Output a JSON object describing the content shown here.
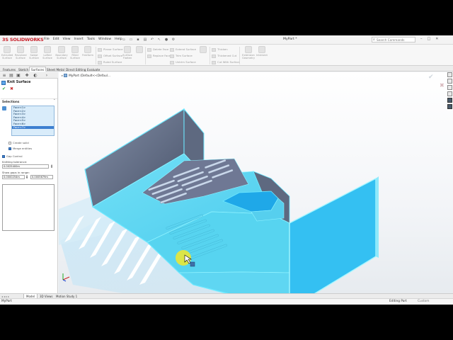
{
  "app": {
    "brand_mark": "3S",
    "brand_name": "SOLIDWORKS",
    "document_title": "MyPart *",
    "search_placeholder": "Search Commands"
  },
  "menu": [
    "File",
    "Edit",
    "View",
    "Insert",
    "Tools",
    "Window",
    "Help"
  ],
  "toolbar": {
    "big_tools": [
      {
        "label": "Extruded Surface",
        "icon": "extrude-surface-icon"
      },
      {
        "label": "Revolved Surface",
        "icon": "revolve-surface-icon"
      },
      {
        "label": "Swept Surface",
        "icon": "swept-surface-icon"
      },
      {
        "label": "Lofted Surface",
        "icon": "lofted-surface-icon"
      },
      {
        "label": "Boundary Surface",
        "icon": "boundary-surface-icon"
      },
      {
        "label": "Filled Surface",
        "icon": "filled-surface-icon"
      },
      {
        "label": "Freeform",
        "icon": "freeform-icon"
      },
      {
        "label": "Surface Flatten",
        "icon": "surface-flatten-icon"
      },
      {
        "label": "Offset Surface",
        "icon": "offset-surface-icon"
      },
      {
        "label": "Trim Surface",
        "icon": "trim-surface-icon"
      },
      {
        "label": "Extend Surface",
        "icon": "extend-surface-icon"
      },
      {
        "label": "Thicken",
        "icon": "thicken-icon"
      },
      {
        "label": "Extension Geometry",
        "icon": "extension-geometry-icon"
      },
      {
        "label": "Intersect",
        "icon": "intersect-icon"
      }
    ],
    "row_tools": [
      {
        "label": "Planar Surface"
      },
      {
        "label": "Offset Surface"
      },
      {
        "label": "Ruled Surface"
      },
      {
        "label": "Delete Face"
      },
      {
        "label": "Replace Face"
      },
      {
        "label": "Extend Surface"
      },
      {
        "label": "Trim Surface"
      },
      {
        "label": "Untrim Surface"
      },
      {
        "label": "Knit Surface"
      },
      {
        "label": "Thicken"
      },
      {
        "label": "Thickened Cut"
      },
      {
        "label": "Cut With Surface"
      }
    ]
  },
  "tabs": [
    {
      "label": "Features",
      "active": false
    },
    {
      "label": "Sketch",
      "active": false
    },
    {
      "label": "Surfaces",
      "active": true
    },
    {
      "label": "Sheet Metal",
      "active": false
    },
    {
      "label": "Direct Editing",
      "active": false
    },
    {
      "label": "Evaluate",
      "active": false
    }
  ],
  "property_manager": {
    "title": "Knit Surface",
    "ok": "✔",
    "cancel": "✖",
    "selections_header": "Selections",
    "faces": [
      "Face<1>",
      "Face<2>",
      "Face<3>",
      "Face<4>",
      "Face<5>",
      "Face<6>",
      "Face<7>"
    ],
    "selected_face_index": 6,
    "create_solid": {
      "label": "Create solid",
      "checked": false
    },
    "merge_entities": {
      "label": "Merge entities",
      "checked": true
    },
    "gap_control": {
      "label": "Gap Control",
      "checked": true
    },
    "knitting_tolerance_label": "Knitting tolerance:",
    "knitting_tolerance_value": "0.0025400m",
    "gaps_range_label": "Show gaps in range:",
    "gap_min": "0.0000254m",
    "gap_max": "0.0005679m"
  },
  "viewport": {
    "tree_label": "MyPart (Default<<Defaul..."
  },
  "bottom_tabs": [
    {
      "label": "Model",
      "active": true
    },
    {
      "label": "3D Views",
      "active": false
    },
    {
      "label": "Motion Study 1",
      "active": false
    }
  ],
  "status": {
    "left": "MyPart",
    "mode": "Editing Part",
    "units": "Custom"
  },
  "colors": {
    "surface_face": "#5fd6f2",
    "surface_dark_wall": "#4f5970",
    "highlight_panel": "#2fb6f0",
    "cursor_halo": "#f5ec2a",
    "accent_selection": "#3d7fd0"
  }
}
